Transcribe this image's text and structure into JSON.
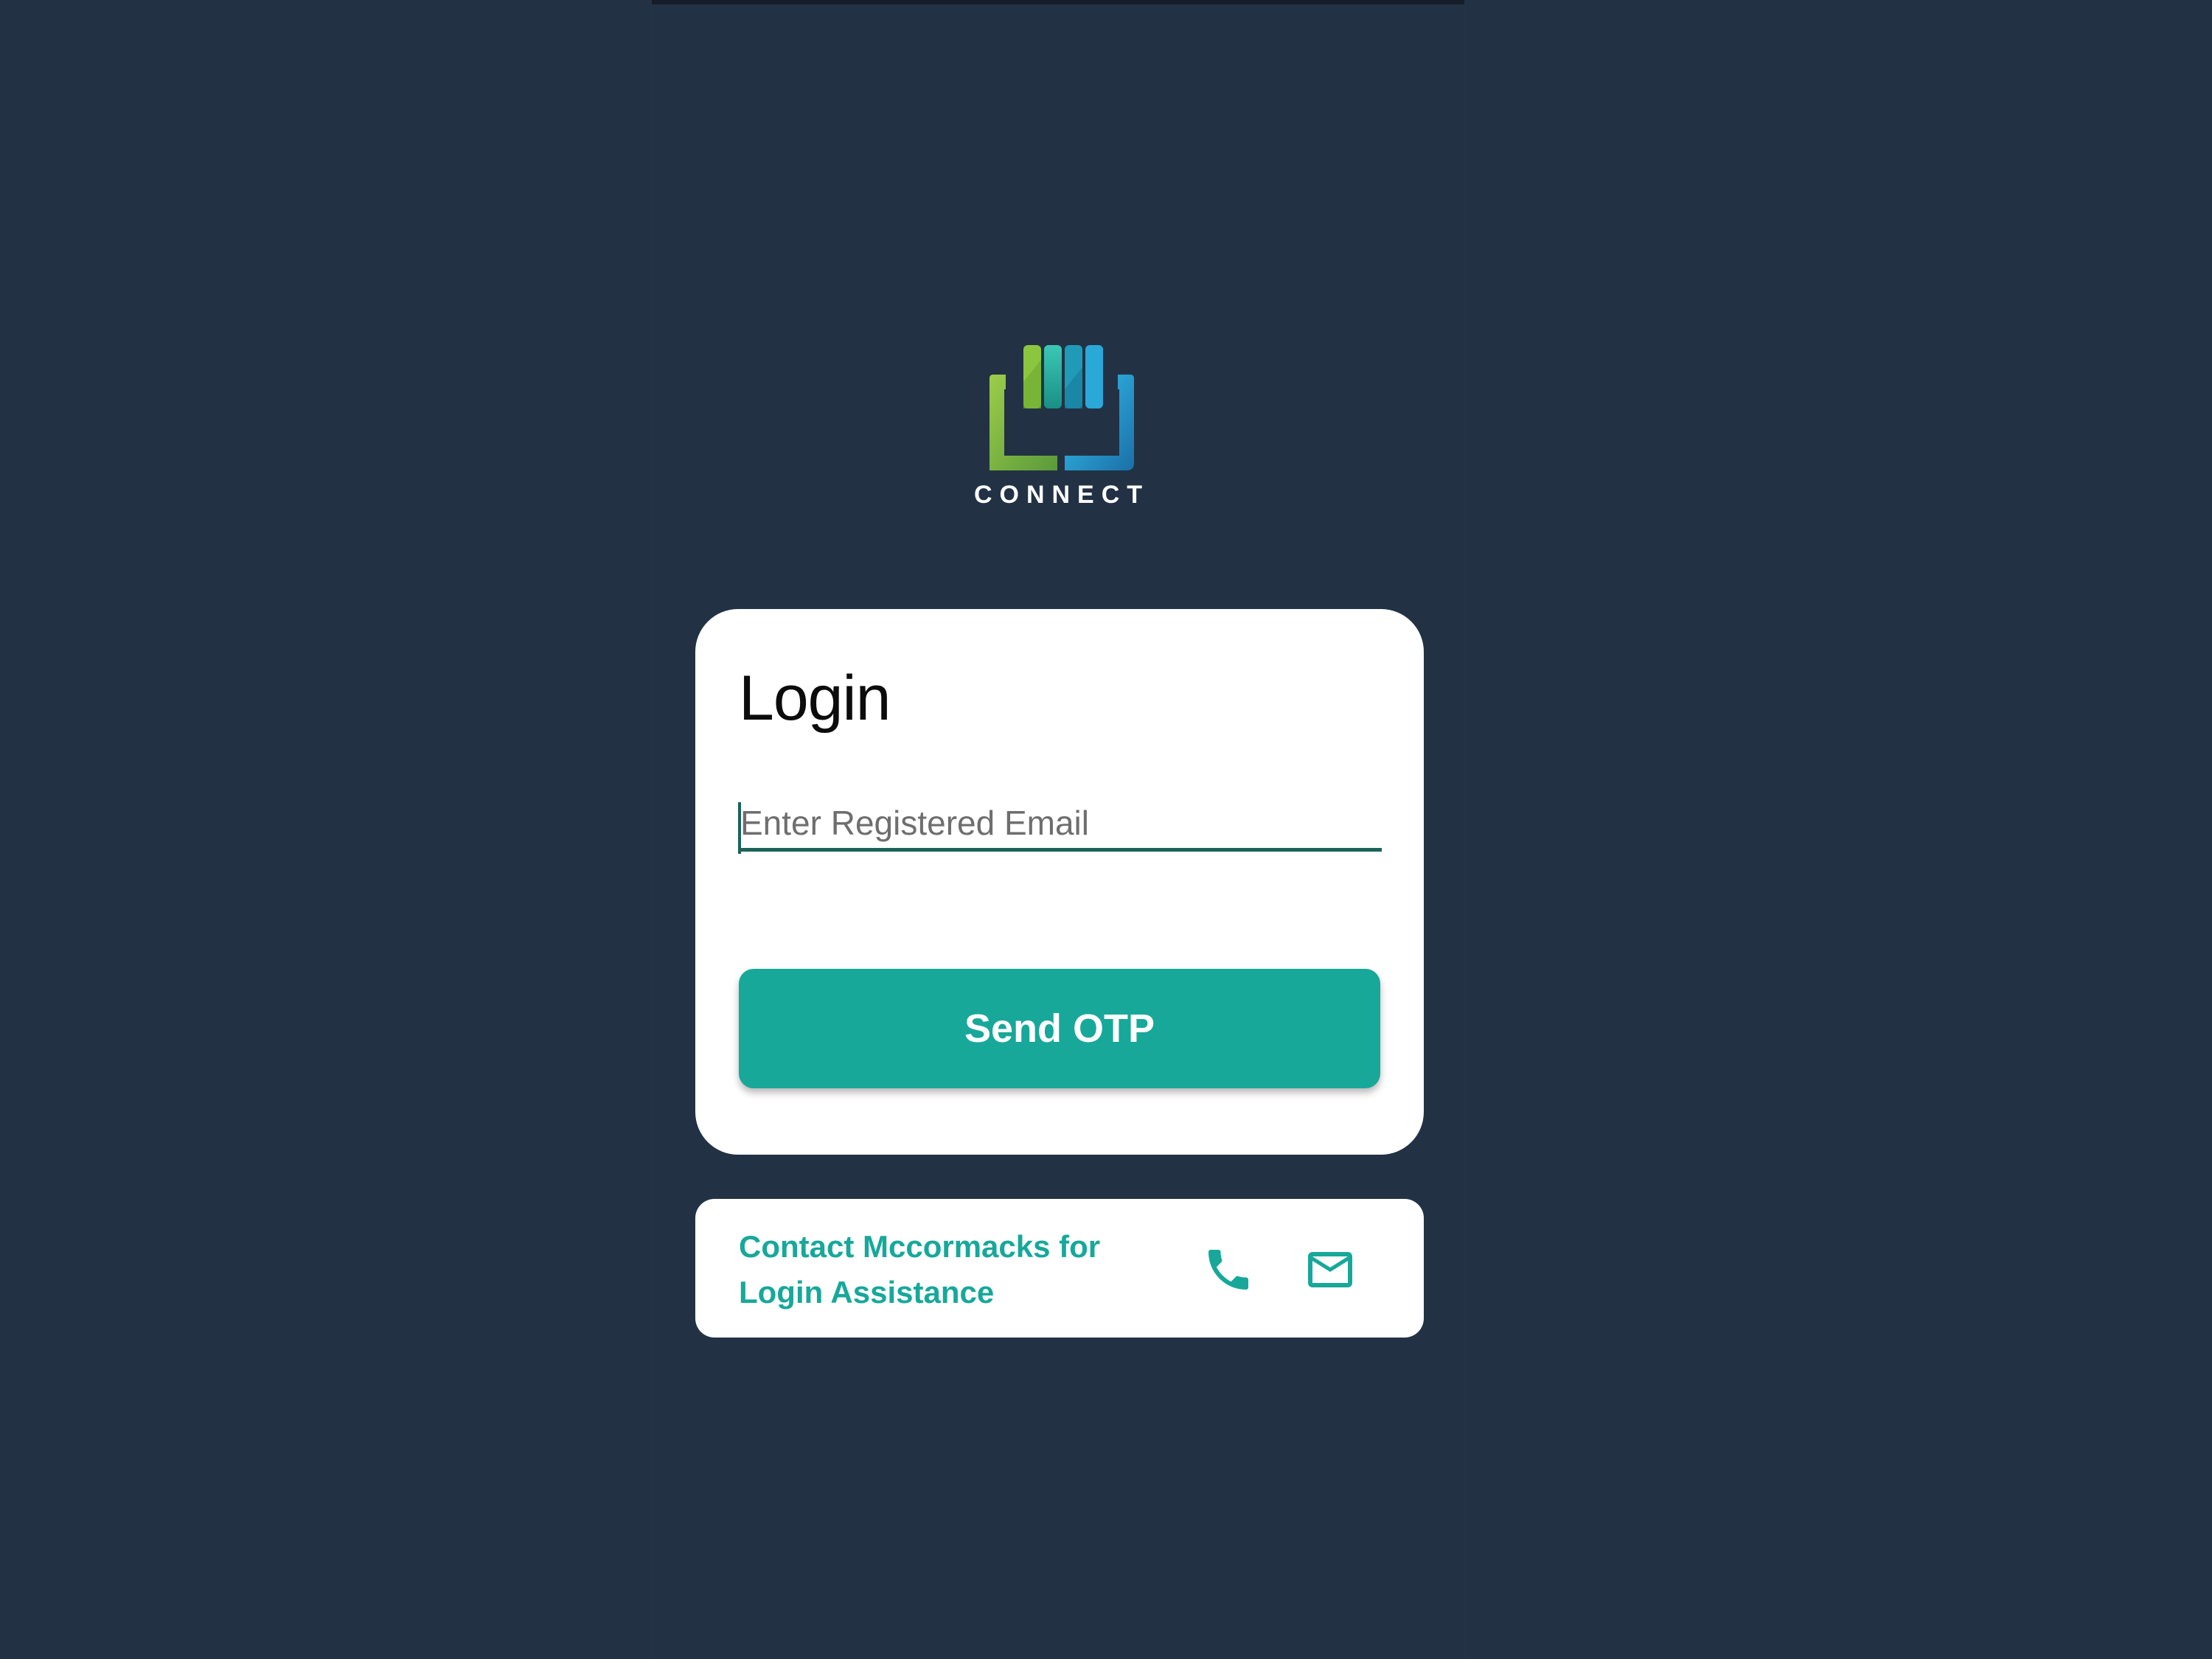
{
  "app": {
    "logo_text": "CONNECT"
  },
  "login": {
    "title": "Login",
    "email_placeholder": "Enter Registered Email",
    "email_value": "",
    "send_otp_label": "Send OTP"
  },
  "contact": {
    "text": "Contact Mccormacks for Login Assistance",
    "icons": [
      "phone-icon",
      "mail-icon"
    ]
  },
  "colors": {
    "background": "#223244",
    "accent": "#17a89a",
    "input_underline": "#1b6359",
    "card": "#ffffff"
  }
}
